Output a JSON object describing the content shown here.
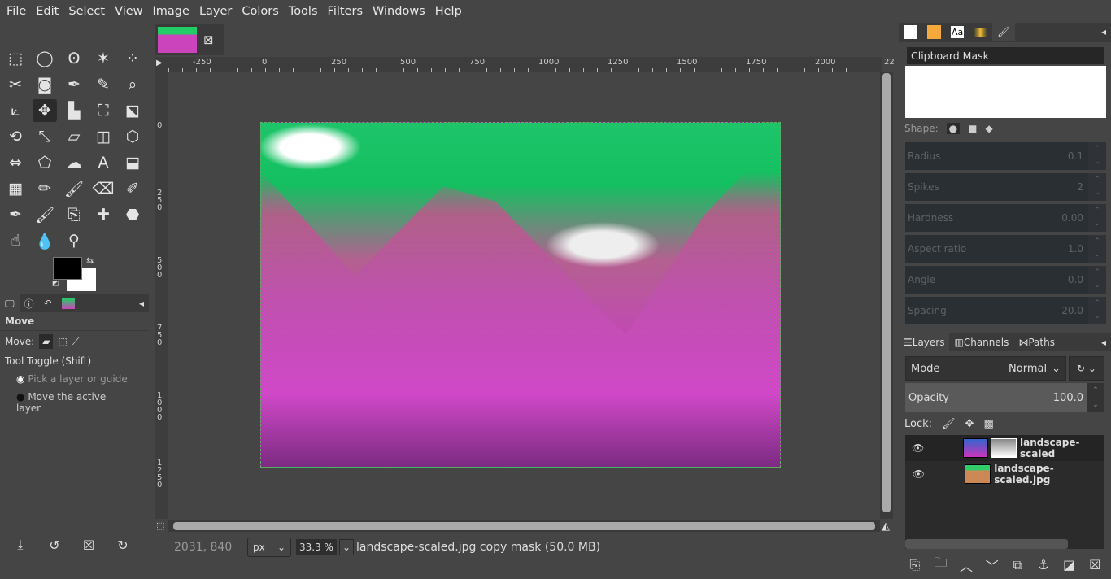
{
  "menu": [
    "File",
    "Edit",
    "Select",
    "View",
    "Image",
    "Layer",
    "Colors",
    "Tools",
    "Filters",
    "Windows",
    "Help"
  ],
  "toolbox": {
    "tools": [
      "rect-select",
      "ellipse-select",
      "free-select",
      "fuzzy-select",
      "select-by-color",
      "scissors",
      "foreground-select",
      "paths",
      "color-picker",
      "zoom",
      "measure",
      "move",
      "align",
      "crop",
      "unified-transform",
      "rotate",
      "scale",
      "shear",
      "perspective",
      "3d-transform",
      "flip",
      "cage",
      "warp",
      "text",
      "bucket-fill",
      "gradient",
      "pencil",
      "paintbrush",
      "eraser",
      "airbrush",
      "ink",
      "mypaint",
      "clone",
      "heal",
      "perspective-clone",
      "smudge",
      "blur",
      "dodge"
    ],
    "glyphs": [
      "⬚",
      "◯",
      "ʘ",
      "✶",
      "⁘",
      "✂",
      "◙",
      "✒",
      "✎",
      "⌕",
      "⟀",
      "✥",
      "▙",
      "⛶",
      "⬕",
      "⟲",
      "⤡",
      "▱",
      "◫",
      "⬡",
      "⇔",
      "⬠",
      "☁",
      "A",
      "⬓",
      "▦",
      "✏",
      "🖌",
      "⌫",
      "✐",
      "✒",
      "🖌",
      "⎘",
      "✚",
      "⬣",
      "☝",
      "💧",
      "⚲"
    ],
    "fg_color": "#000000",
    "bg_color": "#ffffff"
  },
  "tool_options": {
    "tabs": [
      "tool-options-icon",
      "device-status-icon",
      "undo-history-icon",
      "images-icon"
    ],
    "title": "Move",
    "move_label": "Move:",
    "toggle_label": "Tool Toggle  (Shift)",
    "options": [
      "Pick a layer or guide",
      "Move the active layer"
    ],
    "selected": 0,
    "bottom_buttons": [
      "save-icon",
      "reset-icon",
      "delete-icon",
      "restore-icon"
    ]
  },
  "image_tab": {
    "close": "⊠"
  },
  "ruler": {
    "h_labels": [
      "-250",
      "0",
      "250",
      "500",
      "750",
      "1000",
      "1250",
      "1500",
      "1750",
      "2000",
      "22"
    ],
    "v_labels": [
      "0",
      "250",
      "500",
      "750",
      "1000",
      "1250"
    ]
  },
  "status": {
    "coords": "2031, 840",
    "unit": "px",
    "zoom": "33.3 %",
    "info": "landscape-scaled.jpg copy mask (50.0 MB)"
  },
  "brush_panel": {
    "name": "Clipboard Mask",
    "shape_label": "Shape:",
    "fields": [
      {
        "label": "Radius",
        "value": "0.1"
      },
      {
        "label": "Spikes",
        "value": "2"
      },
      {
        "label": "Hardness",
        "value": "0.00"
      },
      {
        "label": "Aspect ratio",
        "value": "1.0"
      },
      {
        "label": "Angle",
        "value": "0.0"
      },
      {
        "label": "Spacing",
        "value": "20.0"
      }
    ]
  },
  "layers_panel": {
    "tabs": [
      "Layers",
      "Channels",
      "Paths"
    ],
    "mode_label": "Mode",
    "mode_value": "Normal",
    "opacity_label": "Opacity",
    "opacity_value": "100.0",
    "lock_label": "Lock:",
    "layers": [
      {
        "name": "landscape-scaled",
        "visible": true,
        "active": true,
        "has_mask": true
      },
      {
        "name": "landscape-scaled.jpg",
        "visible": true,
        "active": false,
        "has_mask": false
      }
    ],
    "buttons": [
      "new-layer",
      "new-group",
      "raise",
      "lower",
      "duplicate",
      "anchor",
      "mask",
      "delete"
    ]
  }
}
